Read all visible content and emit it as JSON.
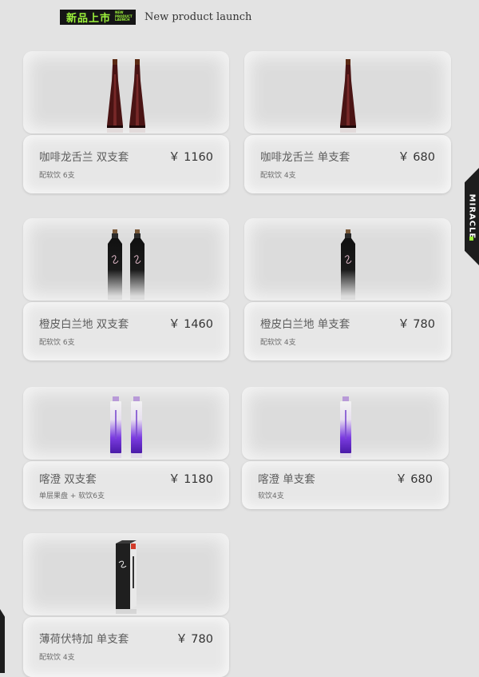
{
  "header": {
    "badge_cn": "新品上市",
    "badge_en": "NEW PRODUCT LAUNCH",
    "title": "New product launch"
  },
  "side_tab": {
    "label": "MIRACLE"
  },
  "products": [
    {
      "name": "咖啡龙舌兰  双支套",
      "price": "￥ 1160",
      "sub": "配软饮 6支",
      "bottle_type": "tequila-bottle",
      "count": 2
    },
    {
      "name": "咖啡龙舌兰  单支套",
      "price": "￥ 680",
      "sub": "配软饮 4支",
      "bottle_type": "tequila-bottle",
      "count": 1
    },
    {
      "name": "橙皮白兰地  双支套",
      "price": "￥ 1460",
      "sub": "配软饮 6支",
      "bottle_type": "brandy-bottle",
      "count": 2
    },
    {
      "name": "橙皮白兰地  单支套",
      "price": "￥ 780",
      "sub": "配软饮 4支",
      "bottle_type": "brandy-bottle",
      "count": 1
    },
    {
      "name": "喀澄  双支套",
      "price": "￥ 1180",
      "sub": "单层果盘 + 软饮6支",
      "bottle_type": "purple-bottle",
      "count": 2
    },
    {
      "name": "喀澄  单支套",
      "price": "￥ 680",
      "sub": "软饮4支",
      "bottle_type": "purple-bottle",
      "count": 1
    },
    {
      "name": "薄荷伏特加  单支套",
      "price": "￥ 780",
      "sub": "配软饮 4支",
      "bottle_type": "vodka-box",
      "count": 1
    }
  ]
}
